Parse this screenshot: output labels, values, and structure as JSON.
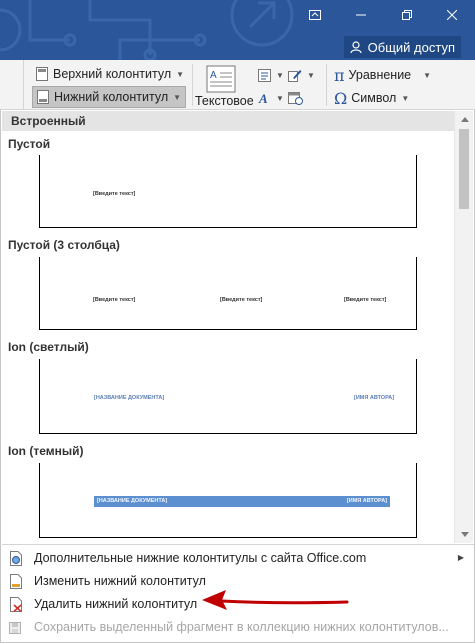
{
  "titlebar": {
    "share_label": "Общий доступ",
    "icons": [
      "ribbon-display-icon",
      "minimize-icon",
      "restore-icon",
      "close-icon"
    ],
    "color": "#2b579a"
  },
  "ribbon": {
    "header_label": "Верхний колонтитул",
    "footer_label": "Нижний колонтитул",
    "text_label": "Текстовое",
    "equation_label": "Уравнение",
    "symbol_label": "Символ"
  },
  "gallery": {
    "header": "Встроенный",
    "items": [
      {
        "title": "Пустой",
        "placeholders": [
          "[Введите текст]"
        ]
      },
      {
        "title": "Пустой (3 столбца)",
        "placeholders": [
          "[Введите текст]",
          "[Введите текст]",
          "[Введите текст]"
        ]
      },
      {
        "title": "Ion (светлый)",
        "placeholders": [
          "[НАЗВАНИЕ ДОКУМЕНТА]",
          "[ИМЯ АВТОРА]"
        ]
      },
      {
        "title": "Ion (темный)",
        "placeholders": [
          "[НАЗВАНИЕ ДОКУМЕНТА]",
          "[ИМЯ АВТОРА]"
        ]
      }
    ]
  },
  "menu": {
    "items": [
      {
        "label": "Дополнительные нижние колонтитулы с сайта Office.com",
        "enabled": true
      },
      {
        "label": "Изменить нижний колонтитул",
        "enabled": true
      },
      {
        "label": "Удалить нижний колонтитул",
        "enabled": true
      },
      {
        "label": "Сохранить выделенный фрагмент в коллекцию нижних колонтитулов...",
        "enabled": false
      }
    ]
  },
  "colors": {
    "accent": "#2b579a",
    "arrow": "#c00000",
    "bar": "#5b8fcf"
  }
}
